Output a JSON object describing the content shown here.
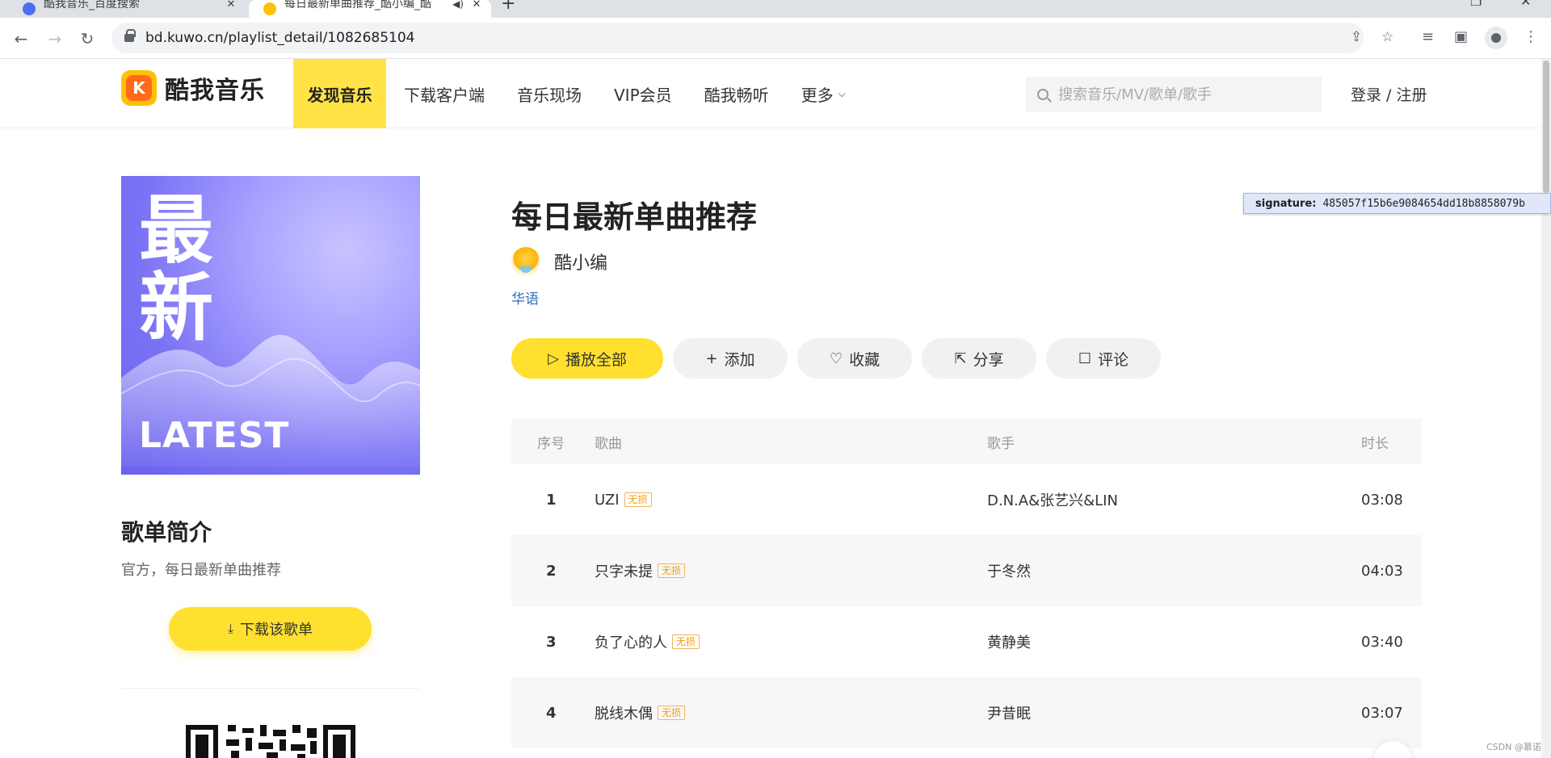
{
  "browser": {
    "tabs": [
      {
        "title": "酷我音乐_百度搜索",
        "active": false
      },
      {
        "title": "每日最新单曲推荐_酷小编_酷",
        "active": true
      }
    ],
    "url": "bd.kuwo.cn/playlist_detail/1082685104"
  },
  "header": {
    "logo_text": "酷我音乐",
    "nav": [
      {
        "label": "发现音乐",
        "active": true
      },
      {
        "label": "下载客户端"
      },
      {
        "label": "音乐现场"
      },
      {
        "label": "VIP会员"
      },
      {
        "label": "酷我畅听"
      },
      {
        "label": "更多"
      }
    ],
    "search_placeholder": "搜索音乐/MV/歌单/歌手",
    "login": "登录 / 注册"
  },
  "cover": {
    "line1": "最",
    "line2": "新",
    "latest": "LATEST"
  },
  "intro": {
    "title": "歌单简介",
    "desc": "官方，每日最新单曲推荐",
    "download_label": "下载该歌单"
  },
  "playlist": {
    "title": "每日最新单曲推荐",
    "creator": "酷小编",
    "tag": "华语",
    "actions": {
      "play_all": "播放全部",
      "add": "添加",
      "collect": "收藏",
      "share": "分享",
      "comment": "评论"
    }
  },
  "table": {
    "headers": {
      "index": "序号",
      "song": "歌曲",
      "artist": "歌手",
      "duration": "时长"
    },
    "rows": [
      {
        "index": "1",
        "song": "UZI",
        "badge": "无损",
        "artist": "D.N.A&张艺兴&LIN",
        "duration": "03:08"
      },
      {
        "index": "2",
        "song": "只字未提",
        "badge": "无损",
        "artist": "于冬然",
        "duration": "04:03"
      },
      {
        "index": "3",
        "song": "负了心的人",
        "badge": "无损",
        "artist": "黄静美",
        "duration": "03:40"
      },
      {
        "index": "4",
        "song": "脱线木偶",
        "badge": "无损",
        "artist": "尹昔眠",
        "duration": "03:07"
      }
    ]
  },
  "tooltip": {
    "key": "signature:",
    "value": "485057f15b6e9084654dd18b8858079b"
  },
  "watermark": "CSDN @慕诺",
  "colors": {
    "accent": "#ffe02e",
    "nav_active": "#ffe347",
    "tag": "#2f6dbd",
    "badge": "#f39c12"
  }
}
